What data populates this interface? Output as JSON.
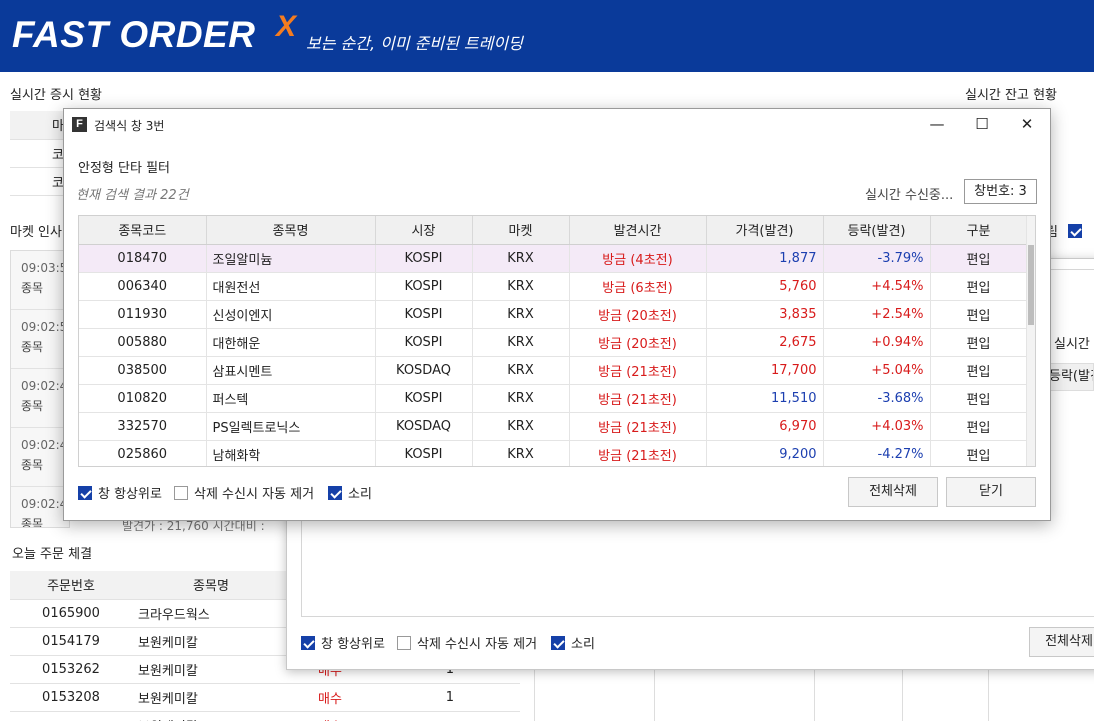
{
  "banner": {
    "brand": "FAST ORDER",
    "brand_x": "X",
    "tagline": "보는 순간, 이미 준비된 트레이딩"
  },
  "background": {
    "market_title": "실시간 증시 현황",
    "balance_title": "실시간 잔고 현황",
    "market_rows": [
      "코",
      "코"
    ],
    "market_header_peek": "마",
    "news_title": "마켓 인사",
    "feed": [
      {
        "time": "09:03:5",
        "label": "종목"
      },
      {
        "time": "09:02:5",
        "label": "종목"
      },
      {
        "time": "09:02:4",
        "label": "종목"
      },
      {
        "time": "09:02:4",
        "label": "종목"
      },
      {
        "time": "09:02:4",
        "label": "종목"
      }
    ],
    "feed_peek": "발견가 : 21,760 시간대비 :",
    "right_peeks": {
      "alarm": "림",
      "realtime": "실시간",
      "change": "등락(발견"
    },
    "orders_title": "오늘 주문 체결",
    "order_headers": [
      "주문번호",
      "종목명"
    ],
    "orders": [
      {
        "no": "0165900",
        "name": "크라우드웍스",
        "side": "",
        "qty": ""
      },
      {
        "no": "0154179",
        "name": "보원케미칼",
        "side": "",
        "qty": ""
      },
      {
        "no": "0153262",
        "name": "보원케미칼",
        "side": "매수",
        "qty": "1"
      },
      {
        "no": "0153208",
        "name": "보원케미칼",
        "side": "매수",
        "qty": "1"
      },
      {
        "no": "",
        "name": "보원케미칼",
        "side": "매수",
        "qty": ""
      }
    ],
    "second_window": {
      "opt_always_on_top": "창 항상위로",
      "opt_auto_remove": "삭제 수신시 자동 제거",
      "opt_sound": "소리",
      "delete_all": "전체삭제"
    }
  },
  "dialog": {
    "title": "검색식 창 3번",
    "filter_name": "안정형 단타 필터",
    "result_count": "현재 검색 결과 22건",
    "receive_status": "실시간 수신중...",
    "window_number": "창번호: 3",
    "columns": [
      "종목코드",
      "종목명",
      "시장",
      "마켓",
      "발견시간",
      "가격(발견)",
      "등락(발견)",
      "구분"
    ],
    "rows": [
      {
        "code": "018470",
        "name": "조일알미늄",
        "market": "KOSPI",
        "venue": "KRX",
        "found": "방금 (4초전)",
        "price": "1,877",
        "change": "-3.79%",
        "dir": "down",
        "type": "편입"
      },
      {
        "code": "006340",
        "name": "대원전선",
        "market": "KOSPI",
        "venue": "KRX",
        "found": "방금 (6초전)",
        "price": "5,760",
        "change": "+4.54%",
        "dir": "up",
        "type": "편입"
      },
      {
        "code": "011930",
        "name": "신성이엔지",
        "market": "KOSPI",
        "venue": "KRX",
        "found": "방금 (20초전)",
        "price": "3,835",
        "change": "+2.54%",
        "dir": "up",
        "type": "편입"
      },
      {
        "code": "005880",
        "name": "대한해운",
        "market": "KOSPI",
        "venue": "KRX",
        "found": "방금 (20초전)",
        "price": "2,675",
        "change": "+0.94%",
        "dir": "up",
        "type": "편입"
      },
      {
        "code": "038500",
        "name": "삼표시멘트",
        "market": "KOSDAQ",
        "venue": "KRX",
        "found": "방금 (21초전)",
        "price": "17,700",
        "change": "+5.04%",
        "dir": "up",
        "type": "편입"
      },
      {
        "code": "010820",
        "name": "퍼스텍",
        "market": "KOSPI",
        "venue": "KRX",
        "found": "방금 (21초전)",
        "price": "11,510",
        "change": "-3.68%",
        "dir": "down",
        "type": "편입"
      },
      {
        "code": "332570",
        "name": "PS일렉트로닉스",
        "market": "KOSDAQ",
        "venue": "KRX",
        "found": "방금 (21초전)",
        "price": "6,970",
        "change": "+4.03%",
        "dir": "up",
        "type": "편입"
      },
      {
        "code": "025860",
        "name": "남해화학",
        "market": "KOSPI",
        "venue": "KRX",
        "found": "방금 (21초전)",
        "price": "9,200",
        "change": "-4.27%",
        "dir": "down",
        "type": "편입"
      }
    ],
    "opt_always_on_top": "창 항상위로",
    "opt_auto_remove": "삭제 수신시 자동 제거",
    "opt_sound": "소리",
    "options_state": {
      "always_on_top": true,
      "auto_remove": false,
      "sound": true
    },
    "delete_all": "전체삭제",
    "close": "닫기"
  },
  "colors": {
    "banner": "#0a3a9a",
    "brand_x": "#f47c20",
    "up": "#d81b1b",
    "down": "#1c3fb0",
    "selected_row": "#f4eaf7",
    "checkbox": "#1540a8"
  }
}
